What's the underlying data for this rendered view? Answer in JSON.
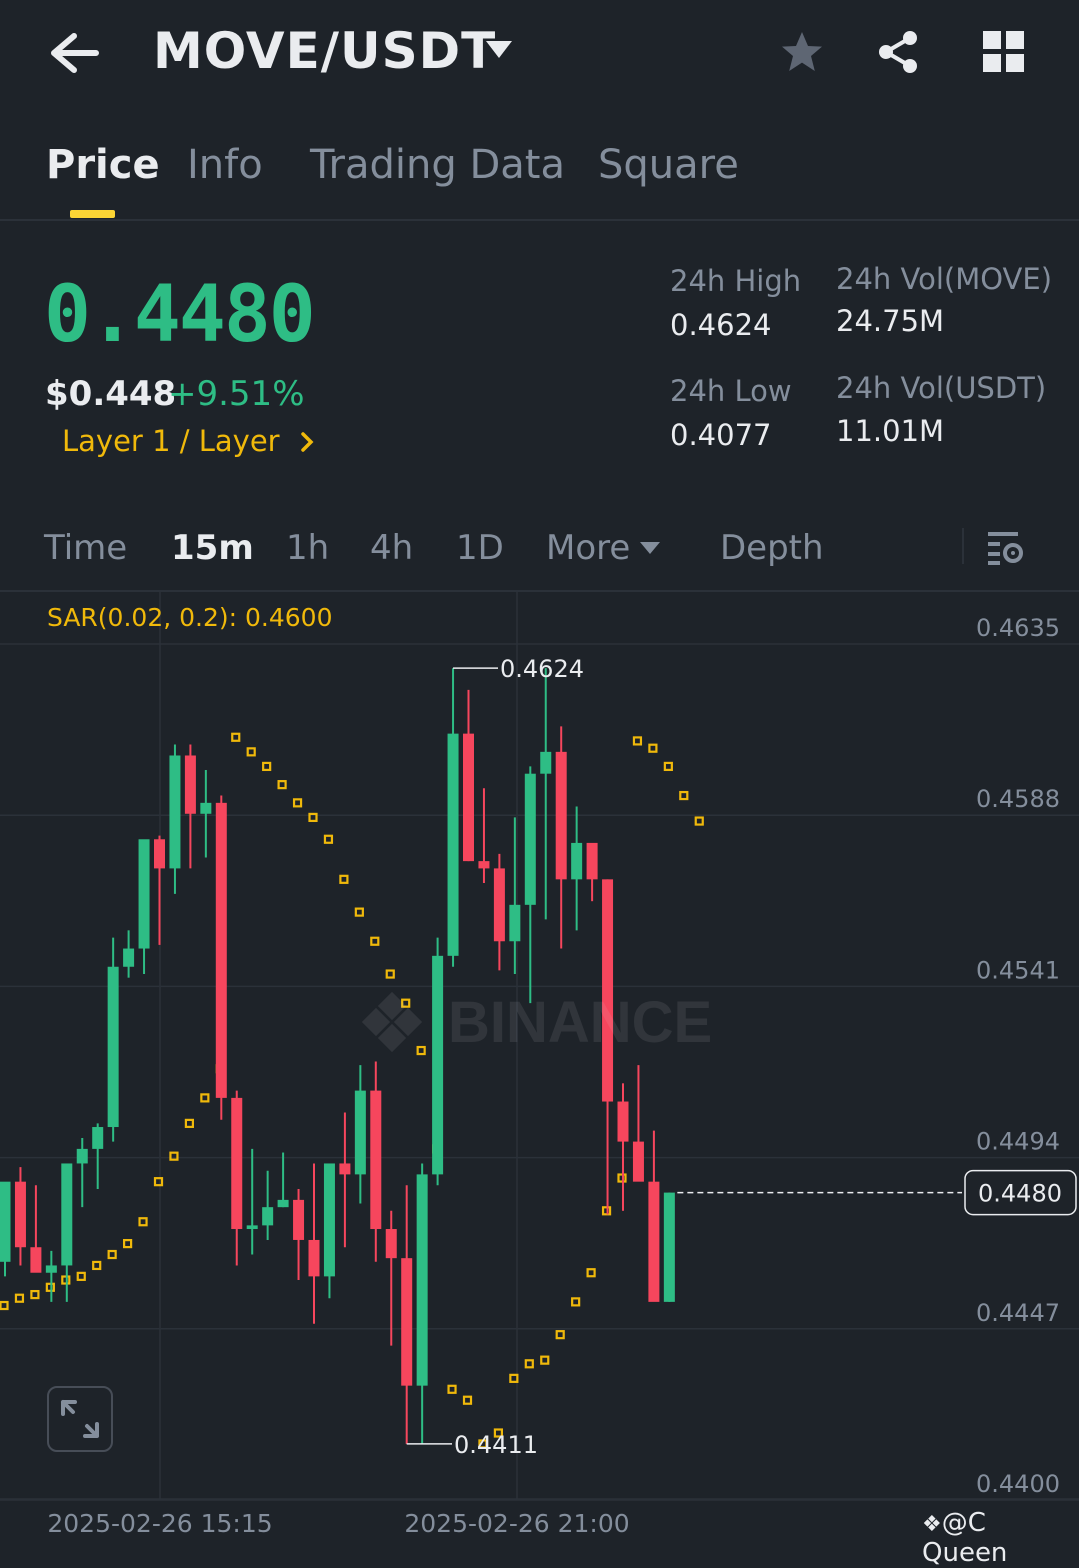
{
  "header": {
    "pair": "MOVE/USDT",
    "icons": [
      "back-arrow-icon",
      "caret-down-icon",
      "star-icon",
      "share-icon",
      "grid-icon"
    ]
  },
  "tabs": [
    {
      "label": "Price",
      "active": true
    },
    {
      "label": "Info",
      "active": false
    },
    {
      "label": "Trading Data",
      "active": false
    },
    {
      "label": "Square",
      "active": false
    }
  ],
  "ticker": {
    "last_price": "0.4480",
    "usd_price": "$0.448",
    "change_pct": "+9.51%",
    "sector": "Layer 1 / Layer",
    "high_label": "24h High",
    "high_value": "0.4624",
    "low_label": "24h Low",
    "low_value": "0.4077",
    "vol_base_label": "24h Vol(MOVE)",
    "vol_base_value": "24.75M",
    "vol_quote_label": "24h Vol(USDT)",
    "vol_quote_value": "11.01M"
  },
  "timeframes": {
    "items": [
      "Time",
      "15m",
      "1h",
      "4h",
      "1D",
      "More",
      "Depth"
    ],
    "active": "15m"
  },
  "indicator": {
    "sar_label": "SAR(0.02, 0.2): 0.4600"
  },
  "chart_data": {
    "type": "candlestick",
    "ylim": [
      0.44,
      0.4635
    ],
    "y_ticks": [
      "0.4635",
      "0.4588",
      "0.4541",
      "0.4494",
      "0.4447",
      "0.4400"
    ],
    "x_ticks": [
      "2025-02-26 15:15",
      "2025-02-26 21:00"
    ],
    "current_price_label": "0.4480",
    "high_marker": "0.4624",
    "low_marker": "0.4411",
    "watermark": "BINANCE",
    "candles": [
      {
        "o": 0.4461,
        "h": 0.4482,
        "l": 0.4457,
        "c": 0.4483
      },
      {
        "o": 0.4483,
        "h": 0.4487,
        "l": 0.446,
        "c": 0.4465
      },
      {
        "o": 0.4465,
        "h": 0.4482,
        "l": 0.446,
        "c": 0.4458
      },
      {
        "o": 0.4458,
        "h": 0.4464,
        "l": 0.445,
        "c": 0.446
      },
      {
        "o": 0.446,
        "h": 0.4474,
        "l": 0.445,
        "c": 0.4488
      },
      {
        "o": 0.4488,
        "h": 0.4495,
        "l": 0.4476,
        "c": 0.4492
      },
      {
        "o": 0.4492,
        "h": 0.4499,
        "l": 0.4481,
        "c": 0.4498
      },
      {
        "o": 0.4498,
        "h": 0.455,
        "l": 0.4494,
        "c": 0.4542
      },
      {
        "o": 0.4542,
        "h": 0.4552,
        "l": 0.4539,
        "c": 0.4547
      },
      {
        "o": 0.4547,
        "h": 0.456,
        "l": 0.454,
        "c": 0.4577
      },
      {
        "o": 0.4577,
        "h": 0.4578,
        "l": 0.4548,
        "c": 0.4569
      },
      {
        "o": 0.4569,
        "h": 0.4603,
        "l": 0.4562,
        "c": 0.46
      },
      {
        "o": 0.46,
        "h": 0.4603,
        "l": 0.4569,
        "c": 0.4584
      },
      {
        "o": 0.4584,
        "h": 0.4596,
        "l": 0.4572,
        "c": 0.4587
      },
      {
        "o": 0.4587,
        "h": 0.4589,
        "l": 0.45,
        "c": 0.4506
      },
      {
        "o": 0.4506,
        "h": 0.4508,
        "l": 0.446,
        "c": 0.447
      },
      {
        "o": 0.447,
        "h": 0.4492,
        "l": 0.4463,
        "c": 0.4471
      },
      {
        "o": 0.4471,
        "h": 0.4486,
        "l": 0.4467,
        "c": 0.4476
      },
      {
        "o": 0.4476,
        "h": 0.4491,
        "l": 0.4476,
        "c": 0.4478
      },
      {
        "o": 0.4478,
        "h": 0.4481,
        "l": 0.4456,
        "c": 0.4467
      },
      {
        "o": 0.4467,
        "h": 0.4488,
        "l": 0.4444,
        "c": 0.4457
      },
      {
        "o": 0.4457,
        "h": 0.4484,
        "l": 0.4451,
        "c": 0.4488
      },
      {
        "o": 0.4488,
        "h": 0.4502,
        "l": 0.4465,
        "c": 0.4485
      },
      {
        "o": 0.4485,
        "h": 0.4515,
        "l": 0.4477,
        "c": 0.4508
      },
      {
        "o": 0.4508,
        "h": 0.4516,
        "l": 0.4461,
        "c": 0.447
      },
      {
        "o": 0.447,
        "h": 0.4475,
        "l": 0.4438,
        "c": 0.4462
      },
      {
        "o": 0.4462,
        "h": 0.4482,
        "l": 0.4411,
        "c": 0.4427
      },
      {
        "o": 0.4427,
        "h": 0.4488,
        "l": 0.4411,
        "c": 0.4485
      },
      {
        "o": 0.4485,
        "h": 0.455,
        "l": 0.4482,
        "c": 0.4545
      },
      {
        "o": 0.4545,
        "h": 0.4624,
        "l": 0.4542,
        "c": 0.4606
      },
      {
        "o": 0.4606,
        "h": 0.4618,
        "l": 0.4571,
        "c": 0.4571
      },
      {
        "o": 0.4571,
        "h": 0.4591,
        "l": 0.4565,
        "c": 0.4569
      },
      {
        "o": 0.4569,
        "h": 0.4573,
        "l": 0.4541,
        "c": 0.4549
      },
      {
        "o": 0.4549,
        "h": 0.4583,
        "l": 0.454,
        "c": 0.4559
      },
      {
        "o": 0.4559,
        "h": 0.4597,
        "l": 0.4532,
        "c": 0.4595
      },
      {
        "o": 0.4595,
        "h": 0.4624,
        "l": 0.4555,
        "c": 0.4601
      },
      {
        "o": 0.4601,
        "h": 0.4608,
        "l": 0.4547,
        "c": 0.4566
      },
      {
        "o": 0.4566,
        "h": 0.4586,
        "l": 0.4552,
        "c": 0.4576
      },
      {
        "o": 0.4576,
        "h": 0.4575,
        "l": 0.456,
        "c": 0.4566
      },
      {
        "o": 0.4566,
        "h": 0.4566,
        "l": 0.4474,
        "c": 0.4505
      },
      {
        "o": 0.4505,
        "h": 0.451,
        "l": 0.4475,
        "c": 0.4494
      },
      {
        "o": 0.4494,
        "h": 0.4515,
        "l": 0.4486,
        "c": 0.4483
      },
      {
        "o": 0.4483,
        "h": 0.4497,
        "l": 0.4479,
        "c": 0.445
      },
      {
        "o": 0.445,
        "h": 0.448,
        "l": 0.445,
        "c": 0.448
      }
    ],
    "sar": [
      0.4449,
      0.4451,
      0.4452,
      0.4454,
      0.4456,
      0.4457,
      0.446,
      0.4463,
      0.4466,
      0.4472,
      0.4483,
      0.449,
      0.4499,
      0.4506,
      0.4514,
      0.4605,
      0.4601,
      0.4597,
      0.4592,
      0.4587,
      0.4583,
      0.4577,
      0.4566,
      0.4557,
      0.4549,
      0.454,
      0.4532,
      0.4519,
      0.4492,
      0.4426,
      0.4423,
      0.4411,
      0.4414,
      0.4429,
      0.4433,
      0.4434,
      0.4441,
      0.445,
      0.4458,
      0.4475,
      0.4484,
      0.4604,
      0.4602,
      0.4597,
      0.4589,
      0.4582
    ]
  },
  "credit": "@C Queen"
}
